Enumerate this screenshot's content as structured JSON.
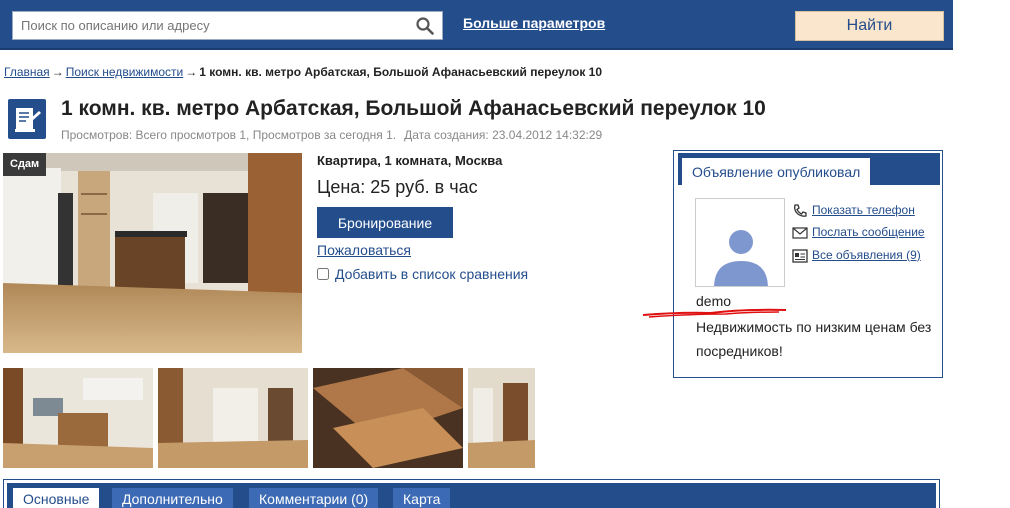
{
  "header": {
    "search_placeholder": "Поиск по описанию или адресу",
    "more_params_label": "Больше параметров",
    "find_label": "Найти"
  },
  "breadcrumb": {
    "items": [
      "Главная",
      "Поиск недвижимости"
    ],
    "separator": "→",
    "current": "1 комн. кв. метро Арбатская, Большой Афанасьевский переулок 10"
  },
  "listing": {
    "title": "1 комн. кв. метро Арбатская, Большой Афанасьевский переулок 10",
    "views": "Просмотров: Всего просмотров 1, Просмотров за сегодня 1.",
    "created": "Дата создания: 23.04.2012 14:32:29",
    "badge": "Сдам",
    "type": "Квартира, 1 комната, Москва",
    "price": "Цена: 25 руб. в час",
    "book_label": "Бронирование",
    "complain_label": "Пожаловаться",
    "compare_label": "Добавить в список сравнения"
  },
  "seller": {
    "tab_label": "Объявление опубликовал",
    "show_phone": "Показать телефон",
    "send_message": "Послать сообщение",
    "all_ads": "Все объявления (9)",
    "name": "demo",
    "description": "Недвижимость по низким ценам без посредников!"
  },
  "tabs": [
    {
      "label": "Основные",
      "active": true
    },
    {
      "label": "Дополнительно",
      "active": false
    },
    {
      "label": "Комментарии (0)",
      "active": false
    },
    {
      "label": "Карта",
      "active": false
    }
  ],
  "colors": {
    "brand": "#244d8c",
    "button_accent": "#fae6cc"
  }
}
